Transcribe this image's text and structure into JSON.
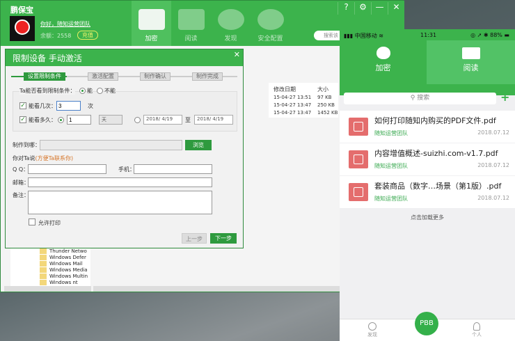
{
  "app": {
    "title": "鹏保宝",
    "greeting": "你好，随知运营团队",
    "balance": "余额：2558",
    "recharge": "充值",
    "search_placeholder": "搜索该",
    "nav": [
      {
        "label": "加密",
        "icon": "folder-icon"
      },
      {
        "label": "阅读",
        "icon": "book-play-icon"
      },
      {
        "label": "发现",
        "icon": "globe-search-icon"
      },
      {
        "label": "安全配置",
        "icon": "gear-icon"
      }
    ],
    "window_buttons": [
      "?",
      "⚙",
      "—",
      "✕"
    ]
  },
  "files": {
    "headers": [
      "修改日期",
      "大小"
    ],
    "rows": [
      [
        "15-04-27 13:51",
        "97 KB"
      ],
      [
        "15-04-27 13:47",
        "250 KB"
      ],
      [
        "15-04-27 13:47",
        "1452 KB"
      ]
    ]
  },
  "tree": [
    "Thunder Netwo",
    "Windows Defer",
    "Windows Mail",
    "Windows Media",
    "Windows Multin",
    "Windows nt"
  ],
  "dialog": {
    "title": "限制设备 手动激活",
    "close": "✕",
    "steps": [
      "设置限制条件",
      "激活配置",
      "制作确认",
      "制作完成"
    ],
    "can_see_label": "Ta能否看到限制条件：",
    "yes": "能",
    "no": "不能",
    "times_label": "能看几次：",
    "times_value": "3",
    "times_unit": "次",
    "duration_label": "能看多久：",
    "duration_value": "1",
    "duration_unit": "天",
    "date_from": "2018/ 4/19",
    "to": "至",
    "date_to": "2018/ 4/19",
    "output_label": "制作到哪：",
    "browse": "浏览",
    "say_label": "你对Ta说",
    "say_hint": "(方便Ta联系你)",
    "qq_label": "Q Q：",
    "phone_label": "手机：",
    "email_label": "邮箱：",
    "note_label": "备注：",
    "allow_print": "允许打印",
    "prev": "上一步",
    "next": "下一步"
  },
  "phone": {
    "carrier": "中国移动",
    "time": "11:31",
    "battery": "88%",
    "tabs": [
      {
        "label": "加密",
        "icon": "heart-lock-icon"
      },
      {
        "label": "阅读",
        "icon": "open-book-icon"
      }
    ],
    "search_placeholder": "搜索",
    "items": [
      {
        "title": "如何打印随知内购买的PDF文件.pdf",
        "author": "随知运营团队",
        "date": "2018.07.12"
      },
      {
        "title": "内容增值概述-suizhi.com-v1.7.pdf",
        "author": "随知运营团队",
        "date": "2018.07.12"
      },
      {
        "title": "套装商品（数字…场景（第1版）.pdf",
        "author": "随知运营团队",
        "date": "2018.07.12"
      }
    ],
    "load_more": "点击加载更多",
    "bottom": {
      "discover": "发现",
      "center": "PBB",
      "profile": "个人"
    }
  },
  "colors": {
    "brand_green": "#3cb34c",
    "file_icon_red": "#e46d6d"
  }
}
